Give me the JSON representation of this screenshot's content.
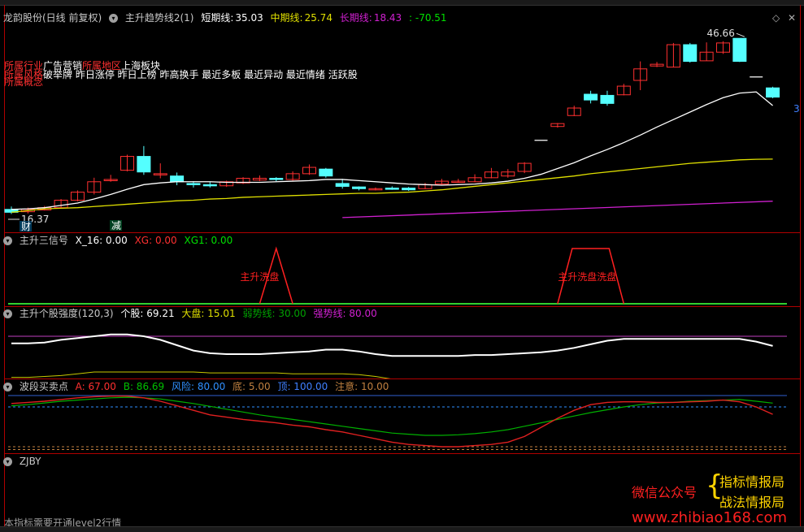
{
  "main_header": {
    "stock": "龙韵股份(日线 前复权)",
    "indicator": "主升趋势线2(1)",
    "short": {
      "label": "短期线:",
      "value": "35.03"
    },
    "mid": {
      "label": "中期线:",
      "value": "25.74"
    },
    "long": {
      "label": "长期线:",
      "value": "18.43"
    },
    "diff": ": -70.51"
  },
  "info_lines": {
    "industry_label": "所属行业",
    "industry_value": "广告营销",
    "region_label": "所属地区",
    "region_value": "上海板块",
    "style_label": "所属风格",
    "style_value": "破举牌 昨日涨停 昨日上榜 昨高换手 最近多板 最近异动 最近情绪 活跃股",
    "concept_label": "所属概念"
  },
  "chart_labels": {
    "high_price": "46.66",
    "low_price": "16.37",
    "marker_cai": "财",
    "marker_jian": "减",
    "right_edge": "3"
  },
  "signal_header": {
    "name": "主升三信号",
    "x16": "X_16: 0.00",
    "xg": "XG: 0.00",
    "xg1": "XG1: 0.00",
    "label1": "主升洗盘",
    "label2": "主升洗盘洗盘"
  },
  "strength_header": {
    "name": "主升个股强度(120,3)",
    "stock": "个股: 69.21",
    "market": "大盘: 15.01",
    "weak": "弱势线: 30.00",
    "strong": "强势线: 80.00"
  },
  "band_header": {
    "name": "波段买卖点",
    "a": "A: 67.00",
    "b": "B: 86.69",
    "risk": "风险: 80.00",
    "bottom": "底: 5.00",
    "top": "顶: 100.00",
    "note": "注意: 10.00"
  },
  "zjby_header": {
    "name": "ZJBY"
  },
  "footer": {
    "notice": "本指标需要开通level2行情"
  },
  "watermark": {
    "wechat": "微信公众号",
    "line1": "指标情报局",
    "line2": "战法情报局",
    "url": "www.zhibiao168.com"
  },
  "colors": {
    "up": "#ff3030",
    "down": "#54ffff",
    "short_line": "#ffffff",
    "mid_line": "#e0e000",
    "long_line": "#d020d0",
    "border": "#b00000"
  },
  "chart_data": {
    "type": "candlestick",
    "candles": [
      [
        17.0,
        16.5,
        17.5,
        16.2
      ],
      [
        16.6,
        17.0,
        17.3,
        16.3
      ],
      [
        16.9,
        17.3,
        17.6,
        16.8
      ],
      [
        17.3,
        18.6,
        18.8,
        17.2
      ],
      [
        18.6,
        20.0,
        20.3,
        18.4
      ],
      [
        20.0,
        21.8,
        22.5,
        19.6
      ],
      [
        22.0,
        22.2,
        23.0,
        21.8
      ],
      [
        23.8,
        26.2,
        26.5,
        23.6
      ],
      [
        26.2,
        23.5,
        28.0,
        23.0
      ],
      [
        23.0,
        23.2,
        25.0,
        22.4
      ],
      [
        22.8,
        21.8,
        23.4,
        21.2
      ],
      [
        21.5,
        21.3,
        21.9,
        20.8
      ],
      [
        21.3,
        21.1,
        21.8,
        20.8
      ],
      [
        21.1,
        21.8,
        22.0,
        20.9
      ],
      [
        21.6,
        22.4,
        22.6,
        21.4
      ],
      [
        22.1,
        22.4,
        22.9,
        21.9
      ],
      [
        22.4,
        22.2,
        22.6,
        21.9
      ],
      [
        22.2,
        23.2,
        23.6,
        22.0
      ],
      [
        23.2,
        24.3,
        24.8,
        23.0
      ],
      [
        24.0,
        22.8,
        24.2,
        22.5
      ],
      [
        21.5,
        21.0,
        22.3,
        20.6
      ],
      [
        20.9,
        20.6,
        21.0,
        20.3
      ],
      [
        20.6,
        20.6,
        20.8,
        20.3
      ],
      [
        20.7,
        20.6,
        21.0,
        20.4
      ],
      [
        20.7,
        20.4,
        20.9,
        20.2
      ],
      [
        20.6,
        21.3,
        21.6,
        20.5
      ],
      [
        21.4,
        21.9,
        22.3,
        21.3
      ],
      [
        21.9,
        21.9,
        22.3,
        21.7
      ],
      [
        21.8,
        22.5,
        23.1,
        21.7
      ],
      [
        22.5,
        23.5,
        24.2,
        22.4
      ],
      [
        22.8,
        23.5,
        24.0,
        22.5
      ],
      [
        23.6,
        25.0,
        25.2,
        23.3
      ],
      [
        29.0,
        29.0,
        29.0,
        29.0
      ],
      [
        31.4,
        31.9,
        32.0,
        31.2
      ],
      [
        33.3,
        34.6,
        35.0,
        33.2
      ],
      [
        37.0,
        36.0,
        37.6,
        35.4
      ],
      [
        36.8,
        35.4,
        37.6,
        35.0
      ],
      [
        36.9,
        38.4,
        38.8,
        36.8
      ],
      [
        39.4,
        41.4,
        42.7,
        37.7
      ],
      [
        41.9,
        42.2,
        42.6,
        41.7
      ],
      [
        41.7,
        45.6,
        45.9,
        41.7
      ],
      [
        45.6,
        42.7,
        45.9,
        42.5
      ],
      [
        42.8,
        44.3,
        46.0,
        42.8
      ],
      [
        44.3,
        45.9,
        46.2,
        44.0
      ],
      [
        46.7,
        42.7,
        46.7,
        42.6
      ],
      [
        40.0,
        40.0,
        40.0,
        40.0
      ],
      [
        38.1,
        36.5,
        38.3,
        36.3
      ]
    ],
    "short_line": [
      17.0,
      17.1,
      17.3,
      17.7,
      18.1,
      18.8,
      19.6,
      20.5,
      21.3,
      21.6,
      21.8,
      21.8,
      21.8,
      21.7,
      21.7,
      21.7,
      21.8,
      21.9,
      22.0,
      22.2,
      22.2,
      22.0,
      21.8,
      21.6,
      21.4,
      21.3,
      21.2,
      21.3,
      21.4,
      21.6,
      21.9,
      22.4,
      23.1,
      24.1,
      25.1,
      26.3,
      27.4,
      28.6,
      29.9,
      31.3,
      32.6,
      33.9,
      35.2,
      36.4,
      37.2,
      37.4,
      35.03
    ],
    "mid_line": [
      16.5,
      16.8,
      17.1,
      17.2,
      17.3,
      17.5,
      17.7,
      17.9,
      18.1,
      18.3,
      18.5,
      18.6,
      18.8,
      18.9,
      19.1,
      19.2,
      19.3,
      19.4,
      19.5,
      19.6,
      19.7,
      19.8,
      19.8,
      19.9,
      20.0,
      20.2,
      20.4,
      20.7,
      21.0,
      21.3,
      21.6,
      21.9,
      22.2,
      22.5,
      22.8,
      23.2,
      23.5,
      23.8,
      24.1,
      24.4,
      24.7,
      25.0,
      25.2,
      25.4,
      25.6,
      25.7,
      25.74
    ],
    "long_line": [
      18.4,
      18.43
    ],
    "signal": {
      "bottom": 0,
      "pulses": [
        [
          15,
          17
        ],
        [
          33,
          37
        ]
      ]
    },
    "strength": {
      "stock": [
        72,
        72,
        73,
        76,
        78,
        80,
        82,
        82,
        80,
        76,
        70,
        64,
        61,
        60,
        60,
        60,
        61,
        62,
        63,
        65,
        65,
        63,
        60,
        58,
        58,
        58,
        58,
        58,
        59,
        59,
        60,
        61,
        62,
        64,
        67,
        71,
        75,
        77,
        77,
        77,
        77,
        77,
        77,
        77,
        77,
        74,
        69.21
      ],
      "market": [
        34,
        34,
        35,
        36,
        38,
        40,
        40,
        40,
        40,
        40,
        40,
        40,
        39,
        39,
        39,
        39,
        39,
        38,
        38,
        38,
        38,
        37,
        35,
        32,
        30,
        29,
        28,
        28,
        28,
        29,
        30,
        30,
        30,
        30,
        31,
        30,
        29,
        27,
        26,
        26,
        26,
        27,
        27,
        28,
        28,
        29,
        31
      ],
      "strong_line": 80
    },
    "band": {
      "a": [
        86,
        88,
        90,
        93,
        96,
        98,
        99,
        99,
        96,
        90,
        82,
        74,
        66,
        62,
        58,
        55,
        52,
        48,
        45,
        40,
        36,
        30,
        24,
        18,
        14,
        12,
        10,
        10,
        12,
        14,
        18,
        28,
        44,
        60,
        74,
        84,
        88,
        89,
        89,
        88,
        88,
        89,
        90,
        92,
        89,
        80,
        67
      ],
      "b": [
        82,
        84,
        87,
        90,
        92,
        94,
        96,
        97,
        96,
        94,
        90,
        86,
        81,
        76,
        71,
        66,
        62,
        58,
        54,
        50,
        46,
        42,
        38,
        34,
        32,
        30,
        30,
        31,
        33,
        36,
        40,
        46,
        52,
        58,
        64,
        70,
        75,
        80,
        84,
        87,
        88,
        90,
        91,
        92,
        93,
        90,
        86.69
      ],
      "risk_line": 80,
      "bottom_line": 5,
      "top_line": 100,
      "note_line": 10
    }
  }
}
